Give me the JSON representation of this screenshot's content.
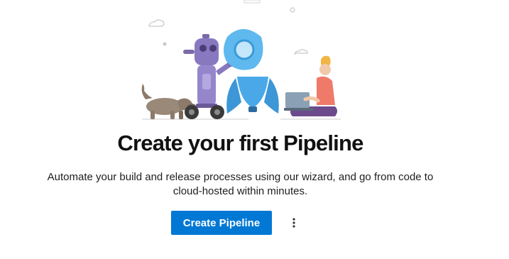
{
  "empty_state": {
    "title": "Create your first Pipeline",
    "description": "Automate your build and release processes using our wizard, and go from code to cloud-hosted within minutes.",
    "primary_button_label": "Create Pipeline",
    "more_button_icon": "more-vertical-icon",
    "illustration_icon": "pipelines-robot-dog-rocket-illustration"
  },
  "colors": {
    "primary": "#0078d4",
    "title": "#111111",
    "text": "#1e1e1e",
    "background": "#ffffff"
  }
}
